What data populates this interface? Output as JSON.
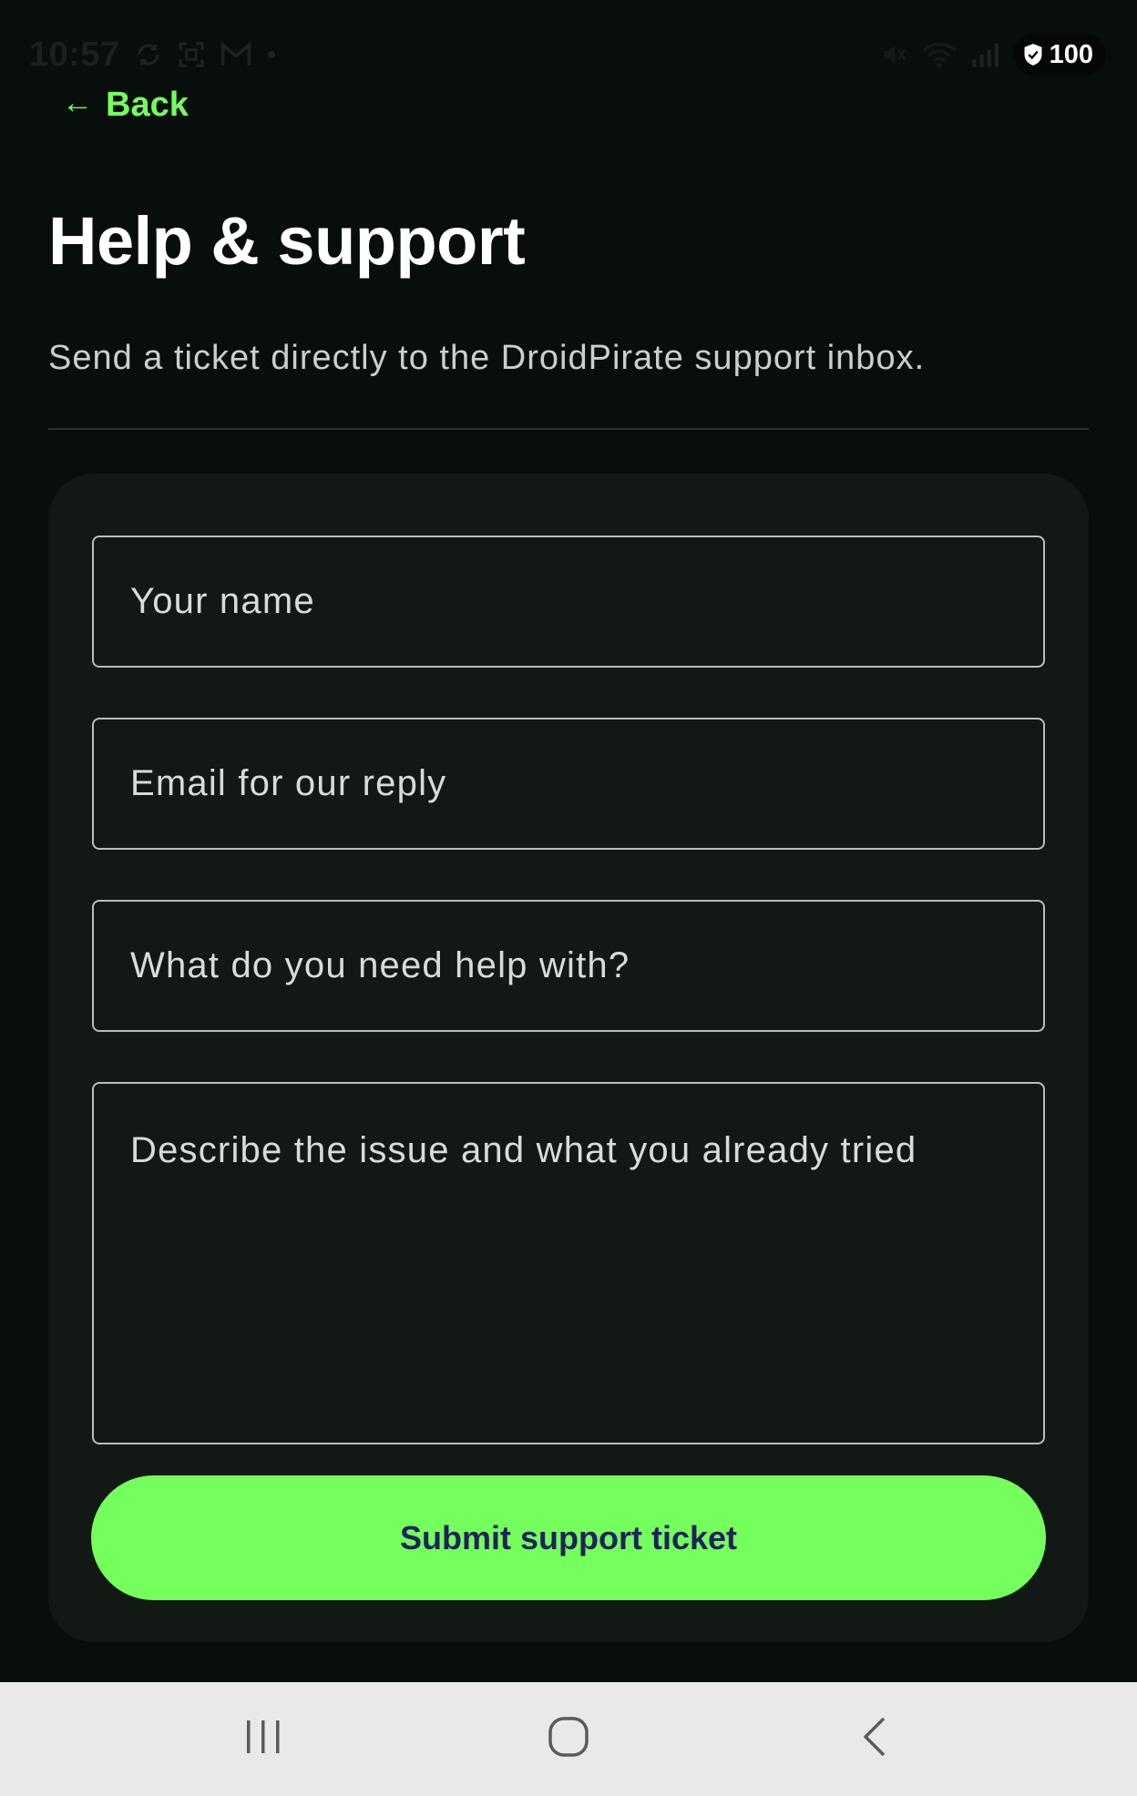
{
  "status_bar": {
    "time": "10:57",
    "battery": "100",
    "icons": [
      "sync-icon",
      "screenshot-icon",
      "gmail-icon",
      "dot-icon",
      "mute-icon",
      "wifi-icon",
      "signal-icon",
      "shield-icon"
    ]
  },
  "back": {
    "arrow": "←",
    "label": "Back"
  },
  "header": {
    "title": "Help & support",
    "subtitle": "Send a ticket directly to the DroidPirate support inbox."
  },
  "form": {
    "name_placeholder": "Your name",
    "email_placeholder": "Email for our reply",
    "subject_placeholder": "What do you need help with?",
    "description_placeholder": "Describe the issue and what you already tried",
    "submit_label": "Submit support ticket"
  },
  "colors": {
    "background": "#070e0b",
    "card": "#121914",
    "accent": "#74ff5c",
    "button_text": "#1f2359"
  },
  "nav_bar": {
    "buttons": [
      "recents-icon",
      "home-icon",
      "back-icon"
    ]
  }
}
